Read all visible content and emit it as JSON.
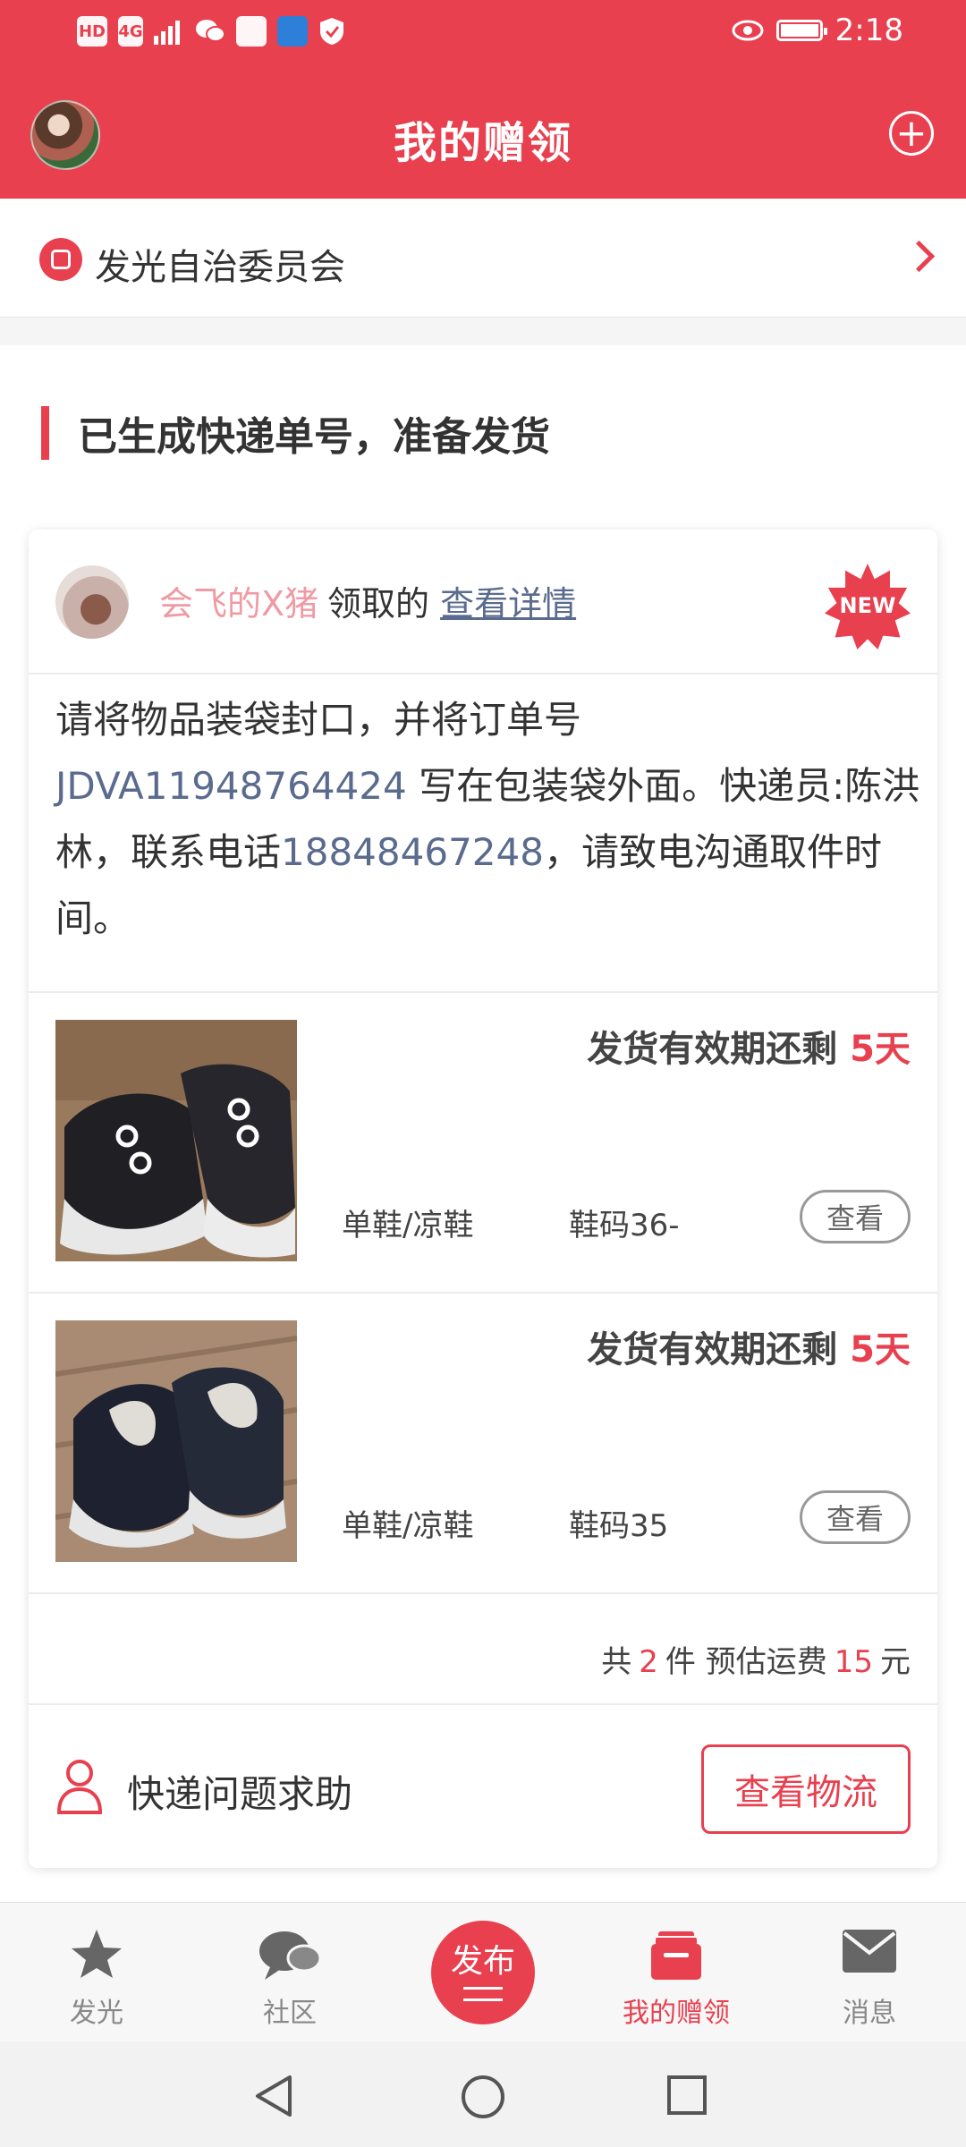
{
  "status_bar": {
    "left_icons": [
      "HD",
      "4G",
      "signal-icon",
      "wechat-icon",
      "huawei-icon",
      "browser-icon",
      "shield-icon"
    ],
    "time": "2:18",
    "right_icons": [
      "eye-icon",
      "battery-icon"
    ]
  },
  "header": {
    "title": "我的赠领",
    "add_icon": "plus-circle-icon"
  },
  "committee": {
    "label": "发光自治委员会"
  },
  "section": {
    "title": "已生成快递单号，准备发货"
  },
  "card": {
    "claimer_name": "会飞的X猪",
    "claimed_text": "领取的",
    "view_detail": "查看详情",
    "new_badge": "NEW",
    "instruction": {
      "part1": "请将物品装袋封口，并将订单号 ",
      "order_no": "JDVA11948764424",
      "part2": " 写在包装袋外面。快递员:陈洪林，联系电话",
      "phone": "18848467248",
      "part3": "，请致电沟通取件时间。"
    },
    "items": [
      {
        "deadline_label": "发货有效期还剩",
        "days": "5天",
        "category": "单鞋/凉鞋",
        "size": "鞋码36-",
        "view": "查看"
      },
      {
        "deadline_label": "发货有效期还剩",
        "days": "5天",
        "category": "单鞋/凉鞋",
        "size": "鞋码35",
        "view": "查看"
      }
    ],
    "summary": {
      "prefix": "共",
      "count": "2",
      "mid": "件 预估运费",
      "fee": "15",
      "suffix": "元"
    },
    "help_label": "快递问题求助",
    "logistics_button": "查看物流"
  },
  "bottom_nav": {
    "items": [
      {
        "label": "发光",
        "icon": "star-icon"
      },
      {
        "label": "社区",
        "icon": "chat-icon"
      },
      {
        "label": "我的赠领",
        "icon": "gift-icon",
        "active": true
      },
      {
        "label": "消息",
        "icon": "mail-icon"
      }
    ],
    "publish_label": "发布"
  },
  "colors": {
    "accent": "#e8404f",
    "link": "#5a6b8e",
    "claimer": "#f09aa3"
  }
}
